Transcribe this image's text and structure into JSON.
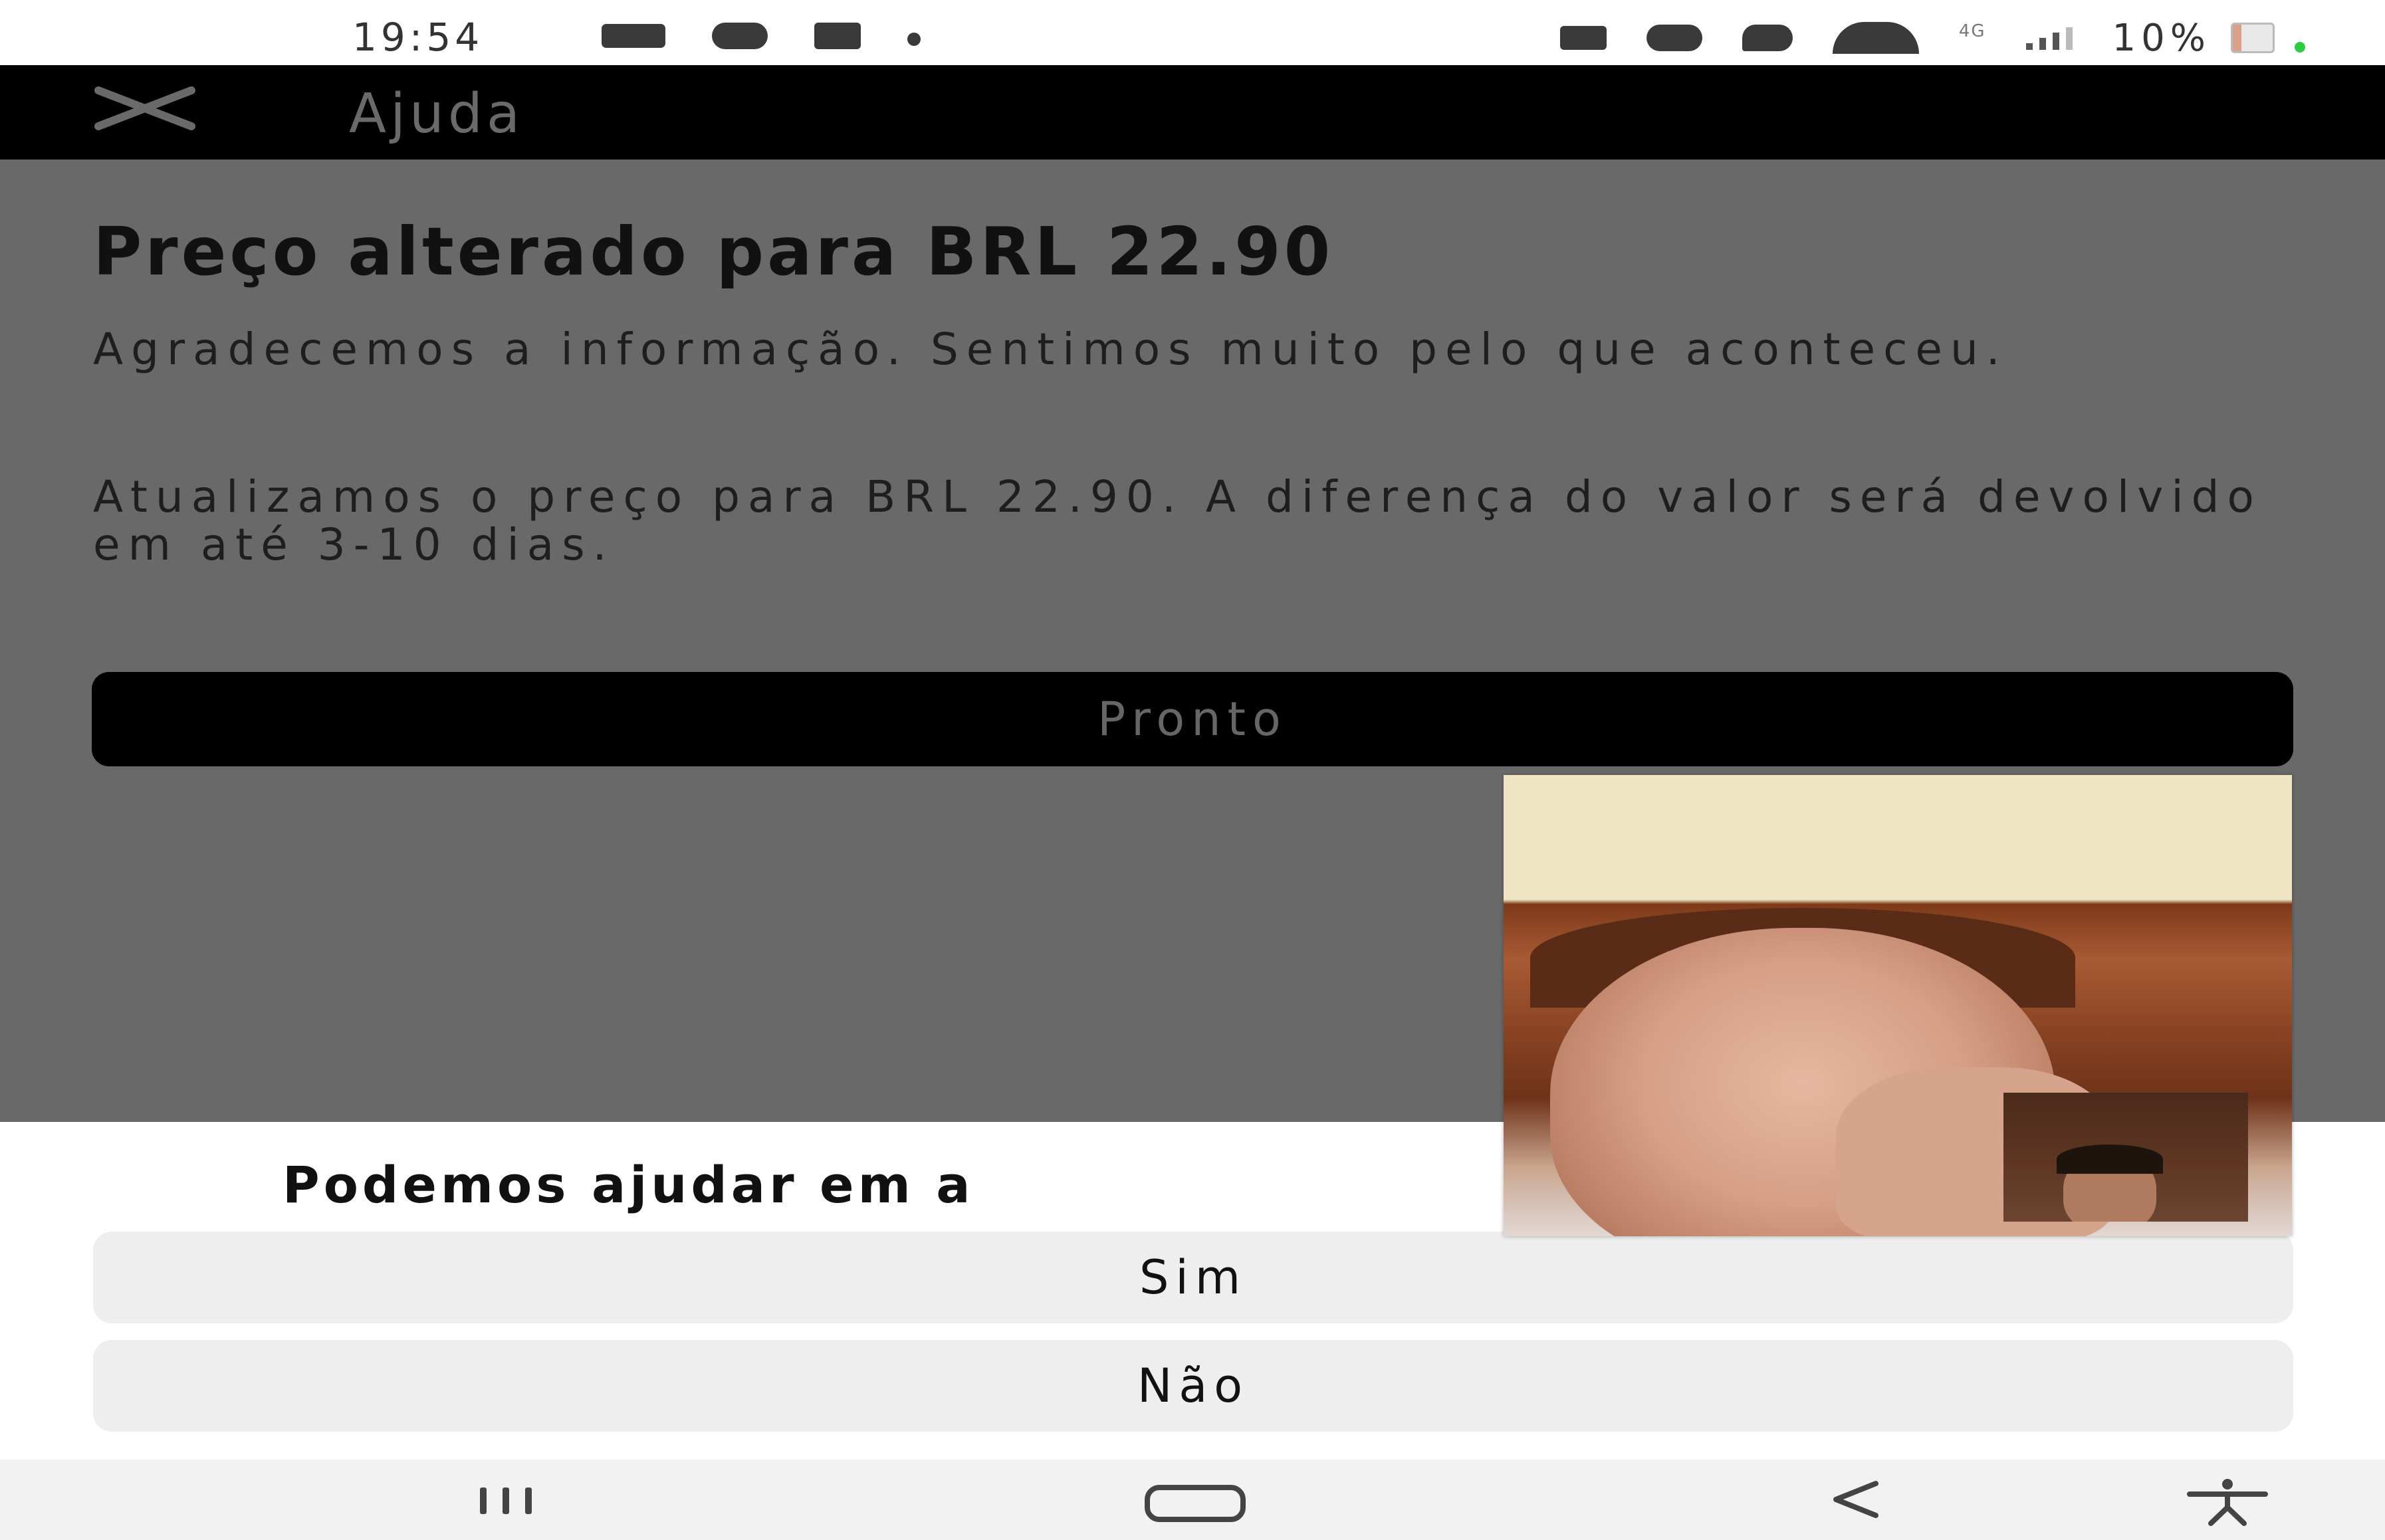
{
  "status_bar": {
    "time": "19:54",
    "network": "4G",
    "battery": "10%",
    "icons_left": [
      "gallery-icon",
      "alarm-icon",
      "alert-icon",
      "dot-icon"
    ],
    "icons_right": [
      "robot-icon",
      "alarm-icon",
      "location-icon",
      "wifi-icon",
      "signal-icon",
      "battery-icon"
    ]
  },
  "app_bar": {
    "title": "Ajuda",
    "close_icon": "close-icon"
  },
  "main": {
    "headline": "Preço alterado para BRL 22.90",
    "paragraph_1": "Agradecemos a informação. Sentimos muito pelo que aconteceu.",
    "paragraph_2": "Atualizamos o preço para BRL 22.90. A diferença do valor será devolvido em até 3-10 dias.",
    "done_button": "Pronto"
  },
  "bottom_sheet": {
    "question": "Podemos ajudar em a",
    "yes_button": "Sim",
    "no_button": "Não"
  },
  "nav_bar": {
    "icons": [
      "recents-icon",
      "home-icon",
      "back-icon",
      "accessibility-icon"
    ]
  },
  "colors": {
    "app_bar_bg": "#000000",
    "dim_overlay": "#696969",
    "sheet_button_bg": "#eeeeee",
    "text_dark": "#111111"
  }
}
